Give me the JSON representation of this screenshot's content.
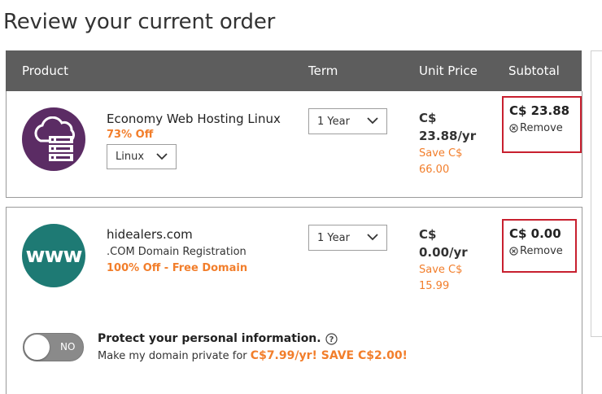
{
  "page": {
    "title": "Review your current order"
  },
  "table_header": {
    "product": "Product",
    "term": "Term",
    "unit_price": "Unit Price",
    "subtotal": "Subtotal"
  },
  "items": [
    {
      "icon": "cloud-server-icon",
      "icon_color": "#5b2c64",
      "name": "Economy Web Hosting Linux",
      "discount": "73% Off",
      "os_select": "Linux",
      "term": "1 Year",
      "price_currency": "C$",
      "price_value": "23.88/yr",
      "save_label": "Save C$",
      "save_value": "66.00",
      "subtotal": "C$ 23.88",
      "remove_label": "Remove"
    },
    {
      "icon": "www-globe-icon",
      "icon_text": "www",
      "icon_color": "#1e7a74",
      "name": "hidealers.com",
      "description": ".COM Domain Registration",
      "discount": "100% Off - Free Domain",
      "term": "1 Year",
      "price_currency": "C$",
      "price_value": "0.00/yr",
      "save_label": "Save C$",
      "save_value": "15.99",
      "subtotal": "C$ 0.00",
      "remove_label": "Remove"
    }
  ],
  "privacy": {
    "toggle_label": "NO",
    "title": "Protect your personal information.",
    "subtitle": "Make my domain private for ",
    "offer": "C$7.99/yr! SAVE C$2.00!"
  },
  "colors": {
    "header_bg": "#5d5d5d",
    "accent_orange": "#f27e2b",
    "highlight_red": "#c8202f"
  }
}
